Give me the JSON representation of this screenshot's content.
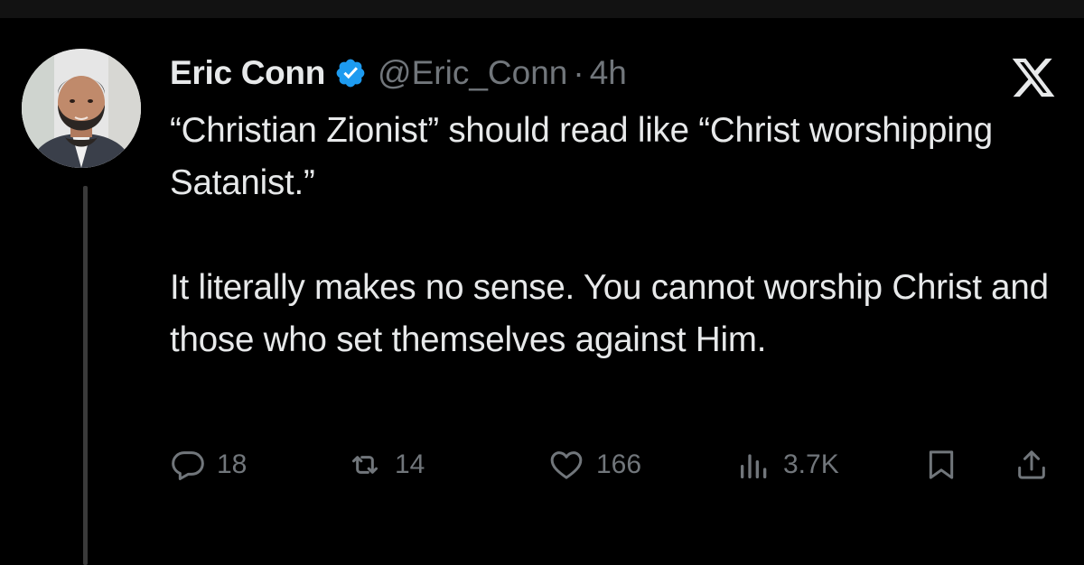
{
  "tweet": {
    "author": {
      "display_name": "Eric Conn",
      "handle": "@Eric_Conn",
      "verified": true
    },
    "separator": "·",
    "time": "4h",
    "paragraphs": [
      "“Christian Zionist” should read like “Christ worshipping Satanist.”",
      "It literally makes no sense. You cannot worship Christ and those who set themselves against Him."
    ],
    "metrics": {
      "replies": "18",
      "reposts": "14",
      "likes": "166",
      "views": "3.7K"
    }
  },
  "icons": {
    "verified": "verified-badge-icon",
    "brand": "x-logo-icon",
    "reply": "reply-icon",
    "repost": "repost-icon",
    "like": "heart-icon",
    "views": "views-icon",
    "bookmark": "bookmark-icon",
    "share": "share-icon"
  },
  "colors": {
    "background": "#000000",
    "text_primary": "#e7e9ea",
    "text_secondary": "#71767b",
    "verified_blue": "#1d9bf0"
  }
}
